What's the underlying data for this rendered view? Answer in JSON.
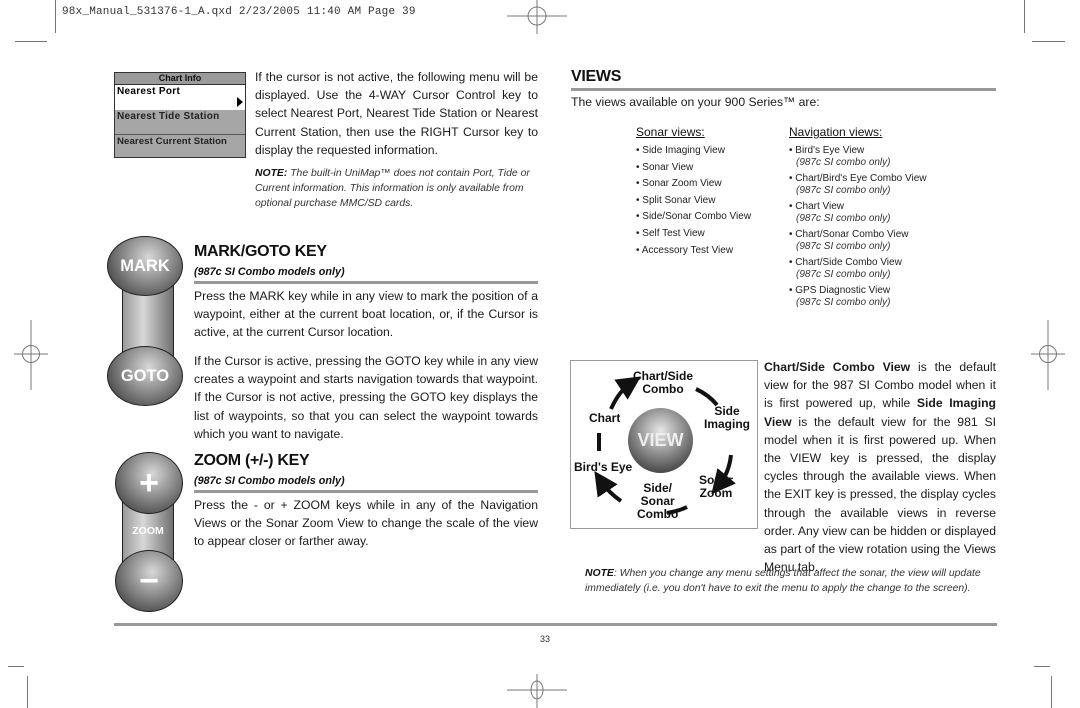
{
  "slug": "98x_Manual_531376-1_A.qxd  2/23/2005  11:40 AM  Page 39",
  "chart_info_menu": {
    "title": "Chart Info",
    "items": [
      {
        "label": "Nearest Port",
        "selected": true,
        "icon": "right-arrow-icon"
      },
      {
        "label": "Nearest Tide Station",
        "selected": false
      },
      {
        "label": "Nearest Current Station",
        "selected": false
      }
    ]
  },
  "intro": {
    "text": "If the cursor is not active, the following menu will be displayed. Use the 4-WAY Cursor Control key to select Nearest Port, Nearest Tide Station or Nearest Current Station, then use the RIGHT Cursor key to display the requested information.",
    "note_label": "NOTE:",
    "note_text": " The built-in UniMap™ does not contain Port, Tide or Current information. This information is only available from optional purchase MMC/SD cards."
  },
  "mark_goto": {
    "key_top": "MARK",
    "key_bottom": "GOTO",
    "heading": "MARK/GOTO KEY",
    "subheading": "(987c SI Combo models only)",
    "para1": "Press the MARK key while in any view to mark the position of a waypoint, either at the current boat location, or, if the Cursor is active, at the current Cursor location.",
    "para2": "If the Cursor is active, pressing the GOTO key while in any view creates a waypoint and starts navigation towards that waypoint. If the Cursor is not active, pressing the GOTO key displays the list of waypoints, so that you can select the waypoint towards which you want to navigate."
  },
  "zoom": {
    "key_top": "+",
    "key_mid": "ZOOM",
    "key_bottom": "−",
    "heading": "ZOOM (+/-) KEY",
    "subheading": "(987c SI Combo models only)",
    "para": "Press the - or + ZOOM keys while in any of the Navigation Views or the Sonar Zoom View to change the scale of the view to appear closer or farther away."
  },
  "views": {
    "heading": "VIEWS",
    "intro": "The views available on your 900 Series™ are:",
    "sonar_heading": "Sonar views:",
    "sonar_items": [
      "• Side Imaging View",
      "• Sonar View",
      "• Sonar Zoom View",
      "• Split Sonar View",
      "• Side/Sonar Combo View",
      "• Self Test View",
      "• Accessory Test View"
    ],
    "nav_heading": "Navigation views:",
    "nav_items": [
      {
        "name": "• Bird's Eye View",
        "qual": "(987c SI combo only)"
      },
      {
        "name": "• Chart/Bird's Eye Combo View",
        "qual": "(987c SI combo only)"
      },
      {
        "name": "• Chart View",
        "qual": "(987c SI combo only)"
      },
      {
        "name": "• Chart/Sonar Combo View",
        "qual": "(987c SI combo only)"
      },
      {
        "name": "• Chart/Side Combo View",
        "qual": "(987c SI combo only)"
      },
      {
        "name": "• GPS Diagnostic View",
        "qual": "(987c SI combo only)"
      }
    ],
    "diagram": {
      "center": "VIEW",
      "labels": [
        "Chart/Side\nCombo",
        "Side\nImaging",
        "Sonar\nZoom",
        "Side/\nSonar\nCombo",
        "Bird's Eye",
        "Chart"
      ]
    },
    "default_bold1": "Chart/Side Combo View",
    "default_text1": " is the default view for the 987 SI Combo model when it is first powered up, while ",
    "default_bold2": "Side Imaging View",
    "default_text2": " is the default view for the 981 SI model when it is first powered up. When the VIEW key is pressed, the display cycles through the available views. When the EXIT key is pressed, the display cycles through the available views in reverse order. Any view can be hidden or displayed as part of the view rotation using the Views Menu tab.",
    "note_label": "NOTE",
    "note_text": ": When you change any menu settings that affect the sonar, the view will update immediately (i.e. you don't have to exit the menu to apply the change to the screen)."
  },
  "page_number": "33"
}
